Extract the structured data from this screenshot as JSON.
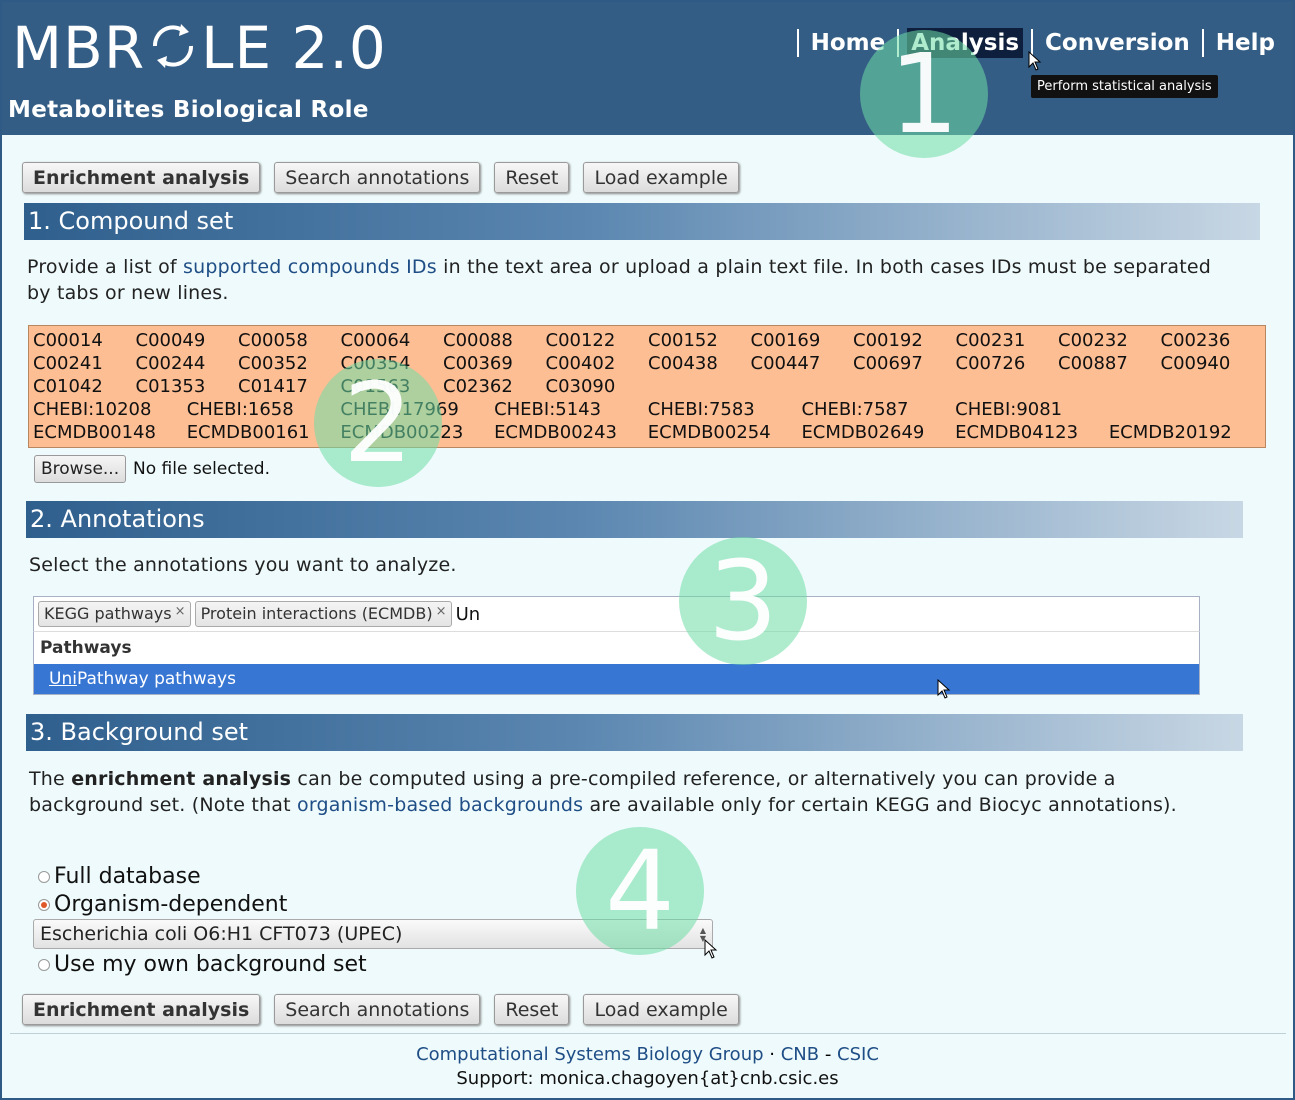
{
  "header": {
    "logo_prefix": "MBR",
    "logo_suffix": "LE 2.0",
    "subtitle": "Metabolites Biological Role"
  },
  "nav": {
    "items": [
      {
        "label": "Home"
      },
      {
        "label": "Analysis"
      },
      {
        "label": "Conversion"
      },
      {
        "label": "Help"
      }
    ],
    "tooltip": "Perform statistical analysis"
  },
  "steps": [
    "1",
    "2",
    "3",
    "4"
  ],
  "actions": {
    "enrichment": "Enrichment analysis",
    "search": "Search annotations",
    "reset": "Reset",
    "example": "Load example"
  },
  "compound_set": {
    "title": "1. Compound set",
    "desc_before": "Provide a list of ",
    "desc_link": "supported compounds IDs",
    "desc_after": " in the text area or upload a plain text file. In both cases IDs must be separated by tabs or new lines.",
    "rows": [
      [
        "C00014",
        "C00049",
        "C00058",
        "C00064",
        "C00088",
        "C00122",
        "C00152",
        "C00169",
        "C00192",
        "C00231",
        "C00232",
        "C00236"
      ],
      [
        "C00241",
        "C00244",
        "C00352",
        "C00354",
        "C00369",
        "C00402",
        "C00438",
        "C00447",
        "C00697",
        "C00726",
        "C00887",
        "C00940"
      ],
      [
        "C01042",
        "C01353",
        "C01417",
        "C01563",
        "C02362",
        "C03090"
      ],
      [
        "CHEBI:10208",
        "CHEBI:1658",
        "CHEBI:17969",
        "CHEBI:5143",
        "CHEBI:7583",
        "CHEBI:7587",
        "CHEBI:9081"
      ],
      [
        "ECMDB00148",
        "ECMDB00161",
        "ECMDB00223",
        "ECMDB00243",
        "ECMDB00254",
        "ECMDB02649",
        "ECMDB04123",
        "ECMDB20192"
      ]
    ],
    "browse_label": "Browse...",
    "file_status": "No file selected."
  },
  "annotations": {
    "title": "2. Annotations",
    "desc": "Select the annotations you want to analyze.",
    "selected": [
      "KEGG pathways",
      "Protein interactions (ECMDB)"
    ],
    "remove_glyph": "×",
    "input_value": "Un",
    "dropdown_group": "Pathways",
    "dropdown_option_match": "Uni",
    "dropdown_option_rest": "Pathway pathways"
  },
  "background": {
    "title": "3. Background set",
    "desc_1": "The ",
    "desc_bold": "enrichment analysis",
    "desc_2": " can be computed using a pre-compiled reference, or alternatively you can provide a background set. (Note that ",
    "desc_link": "organism-based backgrounds",
    "desc_3": " are available only for certain KEGG and Biocyc annotations).",
    "options": [
      {
        "label": "Full database",
        "checked": false
      },
      {
        "label": "Organism-dependent",
        "checked": true
      },
      {
        "label": "Use my own background set",
        "checked": false
      }
    ],
    "organism": "Escherichia coli O6:H1 CFT073 (UPEC)"
  },
  "footer": {
    "group": "Computational Systems Biology Group",
    "sep1": " · ",
    "cnb": "CNB",
    "sep2": " - ",
    "csic": "CSIC",
    "support": "Support: monica.chagoyen{at}cnb.csic.es"
  },
  "colors": {
    "header": "#345d85",
    "textarea": "#fdbe94",
    "highlight": "#3876d3",
    "step_circle": "#6edca5"
  }
}
